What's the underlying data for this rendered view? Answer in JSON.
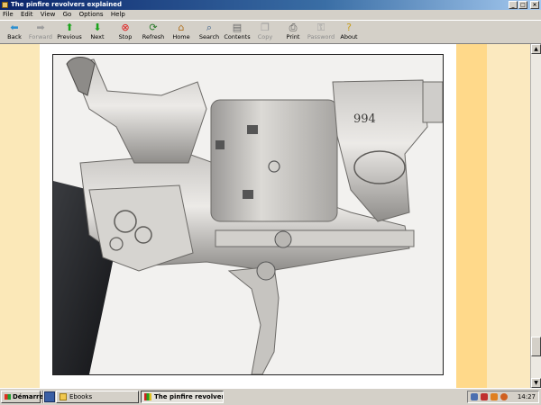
{
  "window": {
    "title": "The pinfire revolvers explained"
  },
  "menu": [
    "File",
    "Edit",
    "View",
    "Go",
    "Options",
    "Help"
  ],
  "toolbar": {
    "buttons": [
      {
        "label": "Back",
        "icon": "back-arrow-icon"
      },
      {
        "label": "Forward",
        "icon": "forward-arrow-icon"
      },
      {
        "label": "Previous",
        "icon": "up-arrow-icon"
      },
      {
        "label": "Next",
        "icon": "down-arrow-icon"
      },
      {
        "label": "Stop",
        "icon": "stop-icon"
      },
      {
        "label": "Refresh",
        "icon": "refresh-icon"
      },
      {
        "label": "Home",
        "icon": "home-icon"
      },
      {
        "label": "Search",
        "icon": "search-icon"
      },
      {
        "label": "Contents",
        "icon": "contents-icon"
      },
      {
        "label": "Copy",
        "icon": "copy-icon"
      },
      {
        "label": "Print",
        "icon": "print-icon"
      },
      {
        "label": "Password",
        "icon": "key-icon"
      },
      {
        "label": "About",
        "icon": "help-icon"
      }
    ]
  },
  "content": {
    "image_engraving_number": "994"
  },
  "taskbar": {
    "start_label": "Démarrer",
    "tasks": [
      {
        "label": "Ebooks"
      },
      {
        "label": "The pinfire revolvers ..."
      }
    ],
    "clock": "14:27"
  },
  "colors": {
    "title_bar": "#0a246a",
    "page_border": "#ffd98a",
    "page_margin": "#fbe8b8"
  }
}
